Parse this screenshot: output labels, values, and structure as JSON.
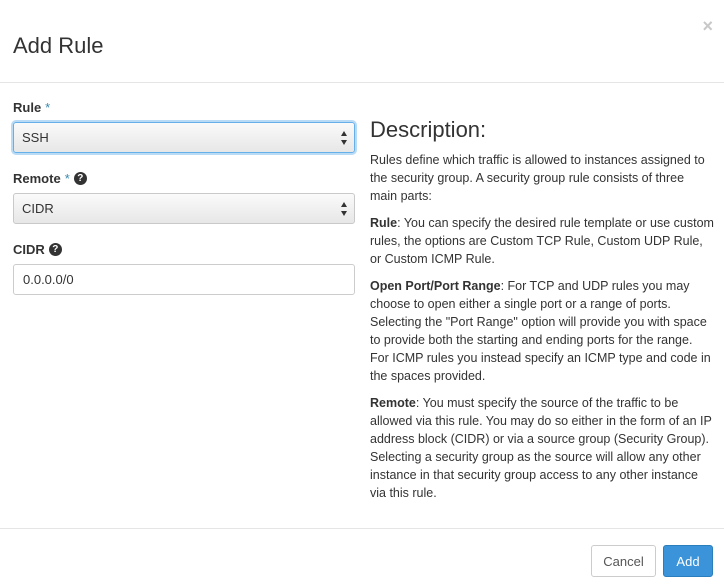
{
  "modal": {
    "title": "Add Rule",
    "close_glyph": "×"
  },
  "form": {
    "rule": {
      "label": "Rule",
      "required": "*",
      "value": "SSH"
    },
    "remote": {
      "label": "Remote",
      "required": "*",
      "help": "?",
      "value": "CIDR"
    },
    "cidr": {
      "label": "CIDR",
      "help": "?",
      "value": "0.0.0.0/0"
    }
  },
  "description": {
    "title": "Description:",
    "intro": "Rules define which traffic is allowed to instances assigned to the security group. A security group rule consists of three main parts:",
    "rule_term": "Rule",
    "rule_text": ": You can specify the desired rule template or use custom rules, the options are Custom TCP Rule, Custom UDP Rule, or Custom ICMP Rule.",
    "port_term": "Open Port/Port Range",
    "port_text": ": For TCP and UDP rules you may choose to open either a single port or a range of ports. Selecting the \"Port Range\" option will provide you with space to provide both the starting and ending ports for the range. For ICMP rules you instead specify an ICMP type and code in the spaces provided.",
    "remote_term": "Remote",
    "remote_text": ": You must specify the source of the traffic to be allowed via this rule. You may do so either in the form of an IP address block (CIDR) or via a source group (Security Group). Selecting a security group as the source will allow any other instance in that security group access to any other instance via this rule."
  },
  "footer": {
    "cancel_label": "Cancel",
    "add_label": "Add"
  },
  "colors": {
    "primary": "#3b94d9",
    "focus": "#66afe9",
    "required_star": "#3a87ad"
  }
}
